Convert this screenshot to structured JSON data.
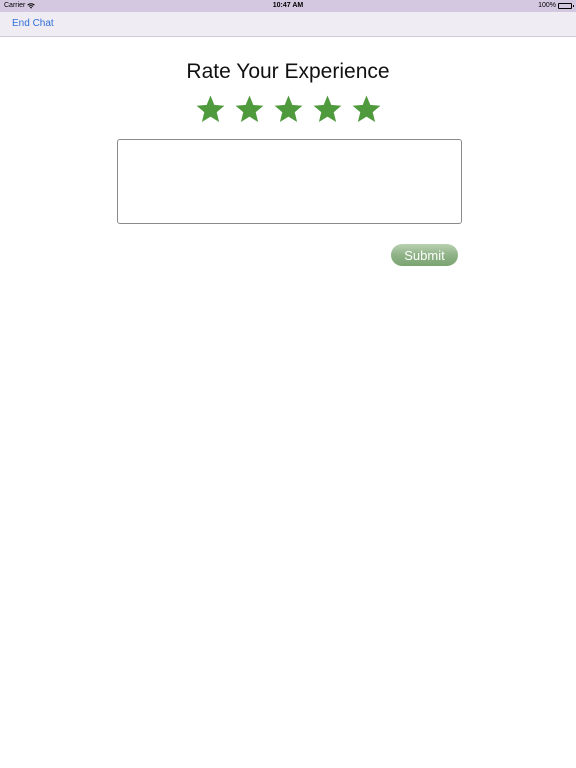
{
  "status_bar": {
    "carrier": "Carrier",
    "time": "10:47 AM",
    "battery": "100%"
  },
  "nav": {
    "end_chat_label": "End Chat"
  },
  "rating": {
    "title": "Rate Your Experience",
    "max_stars": 5,
    "selected_stars": 5,
    "star_color": "#4e9a3c"
  },
  "comment": {
    "value": "",
    "placeholder": ""
  },
  "submit": {
    "label": "Submit"
  },
  "colors": {
    "status_bar_bg": "#d4c8e0",
    "nav_bg": "#f0ecf4",
    "link": "#2f6fd6",
    "submit_green": "#8fb287"
  }
}
